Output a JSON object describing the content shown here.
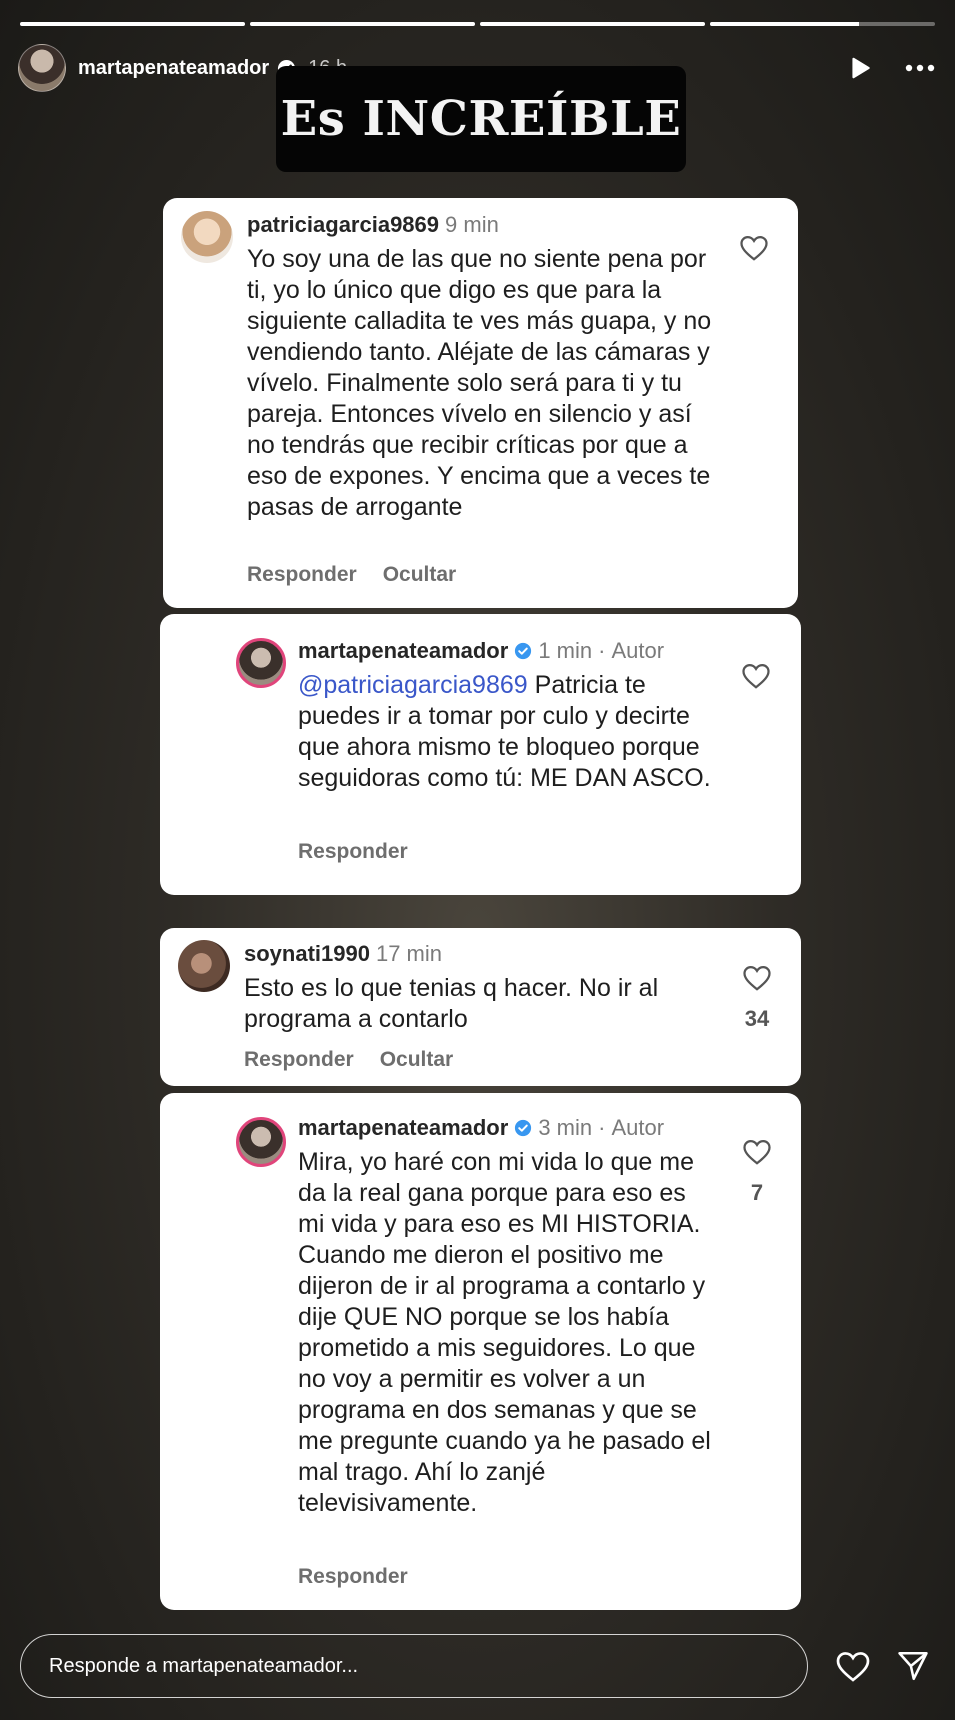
{
  "story": {
    "progress_segments": [
      1,
      1,
      1,
      0.66
    ],
    "username": "martapenateamador",
    "time": "16 h",
    "title": "Es INCREÍBLE"
  },
  "comments": [
    {
      "username": "patriciagarcia9869",
      "time": "9 min",
      "text": "Yo soy una de las que no siente pena por ti, yo lo único que digo es que para la siguiente calladita te ves más guapa, y no vendiendo tanto. Aléjate de las cámaras y vívelo. Finalmente solo será para ti y tu pareja. Entonces vívelo en silencio y así no tendrás que recibir críticas por que a eso de expones. Y encima que a veces te pasas de arrogante",
      "actions": [
        "Responder",
        "Ocultar"
      ]
    },
    {
      "username": "martapenateamador",
      "time": "1 min",
      "author": "Autor",
      "mention": "@patriciagarcia9869",
      "text": "Patricia te puedes ir a tomar por culo y decirte que ahora mismo te bloqueo porque seguidoras como tú: ME DAN ASCO.",
      "actions": [
        "Responder"
      ]
    },
    {
      "username": "soynati1990",
      "time": "17 min",
      "text": "Esto es lo que tenias q hacer. No ir al programa  a contarlo",
      "likes": "34",
      "actions": [
        "Responder",
        "Ocultar"
      ]
    },
    {
      "username": "martapenateamador",
      "time": "3 min",
      "author": "Autor",
      "text": "Mira, yo haré con mi vida lo que me da la real gana porque para eso es mi vida y para eso es MI HISTORIA. Cuando me dieron el positivo me dijeron de ir al programa a contarlo y dije QUE NO porque se los había prometido a mis seguidores. Lo que no voy a permitir es volver a un programa en dos semanas y que se me pregunte cuando ya he pasado el mal trago. Ahí lo zanjé televisivamente.",
      "likes": "7",
      "actions": [
        "Responder"
      ]
    }
  ],
  "reply": {
    "placeholder": "Responde a martapenateamador..."
  },
  "colors": {
    "verified": "#3897f0",
    "mention": "#3a57c9"
  },
  "icons": [
    "play-icon",
    "more-icon",
    "heart-icon",
    "send-icon",
    "verified-badge-icon"
  ]
}
